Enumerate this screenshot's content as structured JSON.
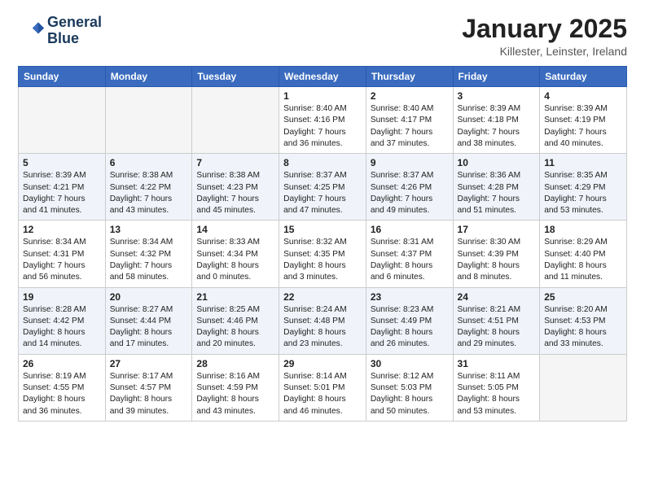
{
  "header": {
    "logo_line1": "General",
    "logo_line2": "Blue",
    "month": "January 2025",
    "location": "Killester, Leinster, Ireland"
  },
  "days_of_week": [
    "Sunday",
    "Monday",
    "Tuesday",
    "Wednesday",
    "Thursday",
    "Friday",
    "Saturday"
  ],
  "weeks": [
    {
      "shade": false,
      "days": [
        {
          "num": "",
          "info": ""
        },
        {
          "num": "",
          "info": ""
        },
        {
          "num": "",
          "info": ""
        },
        {
          "num": "1",
          "info": "Sunrise: 8:40 AM\nSunset: 4:16 PM\nDaylight: 7 hours\nand 36 minutes."
        },
        {
          "num": "2",
          "info": "Sunrise: 8:40 AM\nSunset: 4:17 PM\nDaylight: 7 hours\nand 37 minutes."
        },
        {
          "num": "3",
          "info": "Sunrise: 8:39 AM\nSunset: 4:18 PM\nDaylight: 7 hours\nand 38 minutes."
        },
        {
          "num": "4",
          "info": "Sunrise: 8:39 AM\nSunset: 4:19 PM\nDaylight: 7 hours\nand 40 minutes."
        }
      ]
    },
    {
      "shade": true,
      "days": [
        {
          "num": "5",
          "info": "Sunrise: 8:39 AM\nSunset: 4:21 PM\nDaylight: 7 hours\nand 41 minutes."
        },
        {
          "num": "6",
          "info": "Sunrise: 8:38 AM\nSunset: 4:22 PM\nDaylight: 7 hours\nand 43 minutes."
        },
        {
          "num": "7",
          "info": "Sunrise: 8:38 AM\nSunset: 4:23 PM\nDaylight: 7 hours\nand 45 minutes."
        },
        {
          "num": "8",
          "info": "Sunrise: 8:37 AM\nSunset: 4:25 PM\nDaylight: 7 hours\nand 47 minutes."
        },
        {
          "num": "9",
          "info": "Sunrise: 8:37 AM\nSunset: 4:26 PM\nDaylight: 7 hours\nand 49 minutes."
        },
        {
          "num": "10",
          "info": "Sunrise: 8:36 AM\nSunset: 4:28 PM\nDaylight: 7 hours\nand 51 minutes."
        },
        {
          "num": "11",
          "info": "Sunrise: 8:35 AM\nSunset: 4:29 PM\nDaylight: 7 hours\nand 53 minutes."
        }
      ]
    },
    {
      "shade": false,
      "days": [
        {
          "num": "12",
          "info": "Sunrise: 8:34 AM\nSunset: 4:31 PM\nDaylight: 7 hours\nand 56 minutes."
        },
        {
          "num": "13",
          "info": "Sunrise: 8:34 AM\nSunset: 4:32 PM\nDaylight: 7 hours\nand 58 minutes."
        },
        {
          "num": "14",
          "info": "Sunrise: 8:33 AM\nSunset: 4:34 PM\nDaylight: 8 hours\nand 0 minutes."
        },
        {
          "num": "15",
          "info": "Sunrise: 8:32 AM\nSunset: 4:35 PM\nDaylight: 8 hours\nand 3 minutes."
        },
        {
          "num": "16",
          "info": "Sunrise: 8:31 AM\nSunset: 4:37 PM\nDaylight: 8 hours\nand 6 minutes."
        },
        {
          "num": "17",
          "info": "Sunrise: 8:30 AM\nSunset: 4:39 PM\nDaylight: 8 hours\nand 8 minutes."
        },
        {
          "num": "18",
          "info": "Sunrise: 8:29 AM\nSunset: 4:40 PM\nDaylight: 8 hours\nand 11 minutes."
        }
      ]
    },
    {
      "shade": true,
      "days": [
        {
          "num": "19",
          "info": "Sunrise: 8:28 AM\nSunset: 4:42 PM\nDaylight: 8 hours\nand 14 minutes."
        },
        {
          "num": "20",
          "info": "Sunrise: 8:27 AM\nSunset: 4:44 PM\nDaylight: 8 hours\nand 17 minutes."
        },
        {
          "num": "21",
          "info": "Sunrise: 8:25 AM\nSunset: 4:46 PM\nDaylight: 8 hours\nand 20 minutes."
        },
        {
          "num": "22",
          "info": "Sunrise: 8:24 AM\nSunset: 4:48 PM\nDaylight: 8 hours\nand 23 minutes."
        },
        {
          "num": "23",
          "info": "Sunrise: 8:23 AM\nSunset: 4:49 PM\nDaylight: 8 hours\nand 26 minutes."
        },
        {
          "num": "24",
          "info": "Sunrise: 8:21 AM\nSunset: 4:51 PM\nDaylight: 8 hours\nand 29 minutes."
        },
        {
          "num": "25",
          "info": "Sunrise: 8:20 AM\nSunset: 4:53 PM\nDaylight: 8 hours\nand 33 minutes."
        }
      ]
    },
    {
      "shade": false,
      "days": [
        {
          "num": "26",
          "info": "Sunrise: 8:19 AM\nSunset: 4:55 PM\nDaylight: 8 hours\nand 36 minutes."
        },
        {
          "num": "27",
          "info": "Sunrise: 8:17 AM\nSunset: 4:57 PM\nDaylight: 8 hours\nand 39 minutes."
        },
        {
          "num": "28",
          "info": "Sunrise: 8:16 AM\nSunset: 4:59 PM\nDaylight: 8 hours\nand 43 minutes."
        },
        {
          "num": "29",
          "info": "Sunrise: 8:14 AM\nSunset: 5:01 PM\nDaylight: 8 hours\nand 46 minutes."
        },
        {
          "num": "30",
          "info": "Sunrise: 8:12 AM\nSunset: 5:03 PM\nDaylight: 8 hours\nand 50 minutes."
        },
        {
          "num": "31",
          "info": "Sunrise: 8:11 AM\nSunset: 5:05 PM\nDaylight: 8 hours\nand 53 minutes."
        },
        {
          "num": "",
          "info": ""
        }
      ]
    }
  ]
}
